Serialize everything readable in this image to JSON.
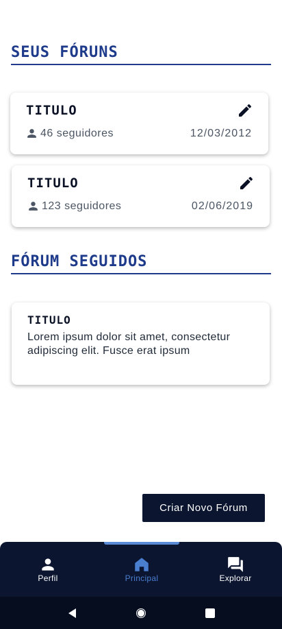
{
  "sections": {
    "my_forums": "SEUS FÓRUNS",
    "followed_forums": "FÓRUM SEGUIDOS"
  },
  "my_forums": [
    {
      "title": "TITULO",
      "followers": "46 seguidores",
      "date": "12/03/2012",
      "icon": "edit-icon"
    },
    {
      "title": "TITULO",
      "followers": "123 seguidores",
      "date": "02/06/2019",
      "icon": "edit-icon"
    }
  ],
  "followed": [
    {
      "title": "TITULO",
      "body": "Lorem ipsum dolor sit amet, consectetur adipiscing elit. Fusce erat ipsum"
    }
  ],
  "actions": {
    "new_forum": "Criar Novo Fórum"
  },
  "nav": {
    "active": "principal",
    "items": [
      {
        "label": "Perfil",
        "icon": "person-icon"
      },
      {
        "label": "Principal",
        "icon": "home-icon"
      },
      {
        "label": "Explorar",
        "icon": "forum-icon"
      }
    ]
  },
  "system_nav": {
    "icons": [
      "back-icon",
      "home-circle-icon",
      "recents-icon"
    ]
  },
  "colors": {
    "accent": "#1e3a8a",
    "nav_bg": "#0b1530",
    "nav_active": "#4a7fd0"
  }
}
